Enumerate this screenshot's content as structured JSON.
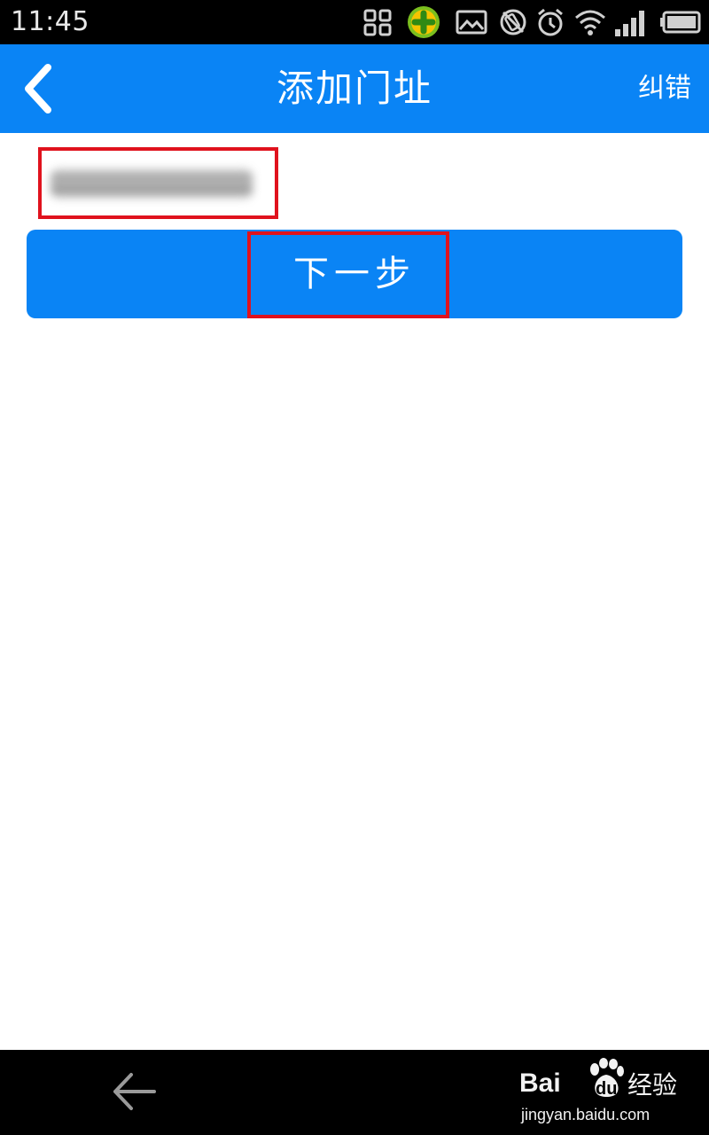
{
  "status_bar": {
    "time": "11:45",
    "icons": [
      "scan-icon",
      "360-security-icon",
      "image-icon",
      "no-rotation-icon",
      "alarm-icon",
      "wifi-icon",
      "signal-icon",
      "battery-icon"
    ]
  },
  "app_bar": {
    "title": "添加门址",
    "back_icon": "chevron-left-icon",
    "action_label": "纠错",
    "background": "#0a84f5"
  },
  "form": {
    "input_value_obscured": true,
    "next_button_label": "下一步",
    "highlight_color": "#e0121d"
  },
  "nav_bar": {
    "back_icon": "arrow-left-icon"
  },
  "watermark": {
    "brand_a": "Bai",
    "brand_b": "du",
    "product": "经验",
    "url": "jingyan.baidu.com"
  }
}
